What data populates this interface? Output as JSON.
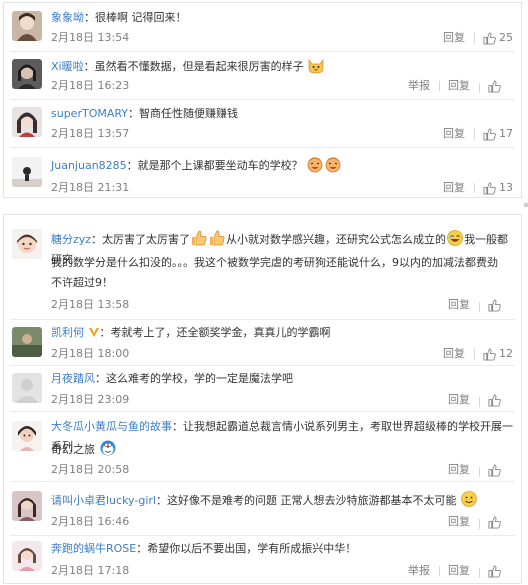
{
  "actions": {
    "reply": "回复",
    "report": "举报"
  },
  "top_comments": [
    {
      "user": "象象呦",
      "text": "很棒啊 记得回来！",
      "time": "2月18日 13:54",
      "likes": "25",
      "report": false
    },
    {
      "user": "Xi暖啦",
      "text": "虽然看不懂数据，但是看起来很厉害的样子",
      "time": "2月18日 16:23",
      "likes": "",
      "report": true
    },
    {
      "user": "superTOMARY",
      "text": "智商任性随便赚赚钱",
      "time": "2月18日 13:57",
      "likes": "17",
      "report": false
    },
    {
      "user": "Juanjuan8285",
      "text": "就是那个上课都要坐动车的学校？",
      "time": "2月18日 21:31",
      "likes": "13",
      "report": false
    }
  ],
  "bottom_comments": [
    {
      "user": "糖分zyz",
      "text_a": "太厉害了太厉害了",
      "text_b": "从小就对数学感兴趣，还研究公式怎么成立的",
      "text_c": "我一般都研究",
      "line2": "我的数学分是什么扣没的。。。我这个被数学完虐的考研狗还能说什么，9以内的加减法都费劲",
      "line3": "不许超过9！",
      "time": "2月18日 13:58",
      "likes": "",
      "report": false
    },
    {
      "user": "凯利何",
      "text": "考就考上了，还全额奖学金，真真儿的学霸啊",
      "time": "2月18日 18:00",
      "likes": "12",
      "report": false
    },
    {
      "user": "月夜踏风",
      "text": "这么难考的学校，学的一定是魔法学吧",
      "time": "2月18日 23:09",
      "likes": "",
      "report": false
    },
    {
      "user": "大冬瓜小黄瓜与鱼的故事",
      "text": "让我想起霸道总裁言情小说系列男主，考取世界超级棒的学校开展一系列",
      "line2": "奇幻之旅",
      "time": "2月18日 20:58",
      "likes": "",
      "report": false
    },
    {
      "user": "请叫小卓君lucky-girl",
      "text": "这好像不是难考的问题 正常人想去沙特旅游都基本不太可能",
      "time": "2月18日 16:46",
      "likes": "",
      "report": false
    },
    {
      "user": "奔跑的蜗牛ROSE",
      "text": "希望你以后不要出国，学有所成振兴中华！",
      "time": "2月18日 17:18",
      "likes": "",
      "report": true
    }
  ]
}
